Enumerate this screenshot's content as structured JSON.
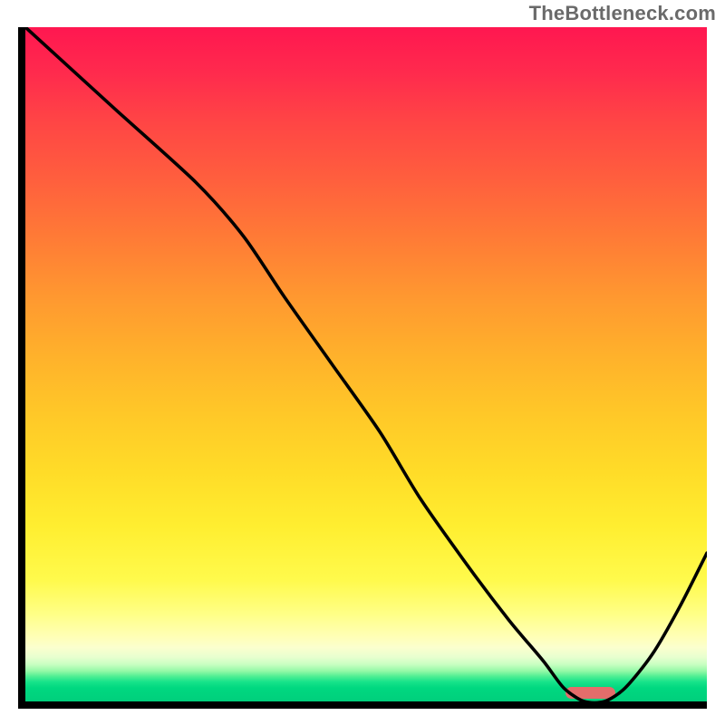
{
  "watermark": "TheBottleneck.com",
  "chart_data": {
    "type": "line",
    "title": "",
    "xlabel": "",
    "ylabel": "",
    "x": [
      0.0,
      0.13,
      0.25,
      0.32,
      0.38,
      0.45,
      0.52,
      0.58,
      0.65,
      0.71,
      0.76,
      0.79,
      0.82,
      0.85,
      0.88,
      0.92,
      0.96,
      1.0
    ],
    "y": [
      1.0,
      0.88,
      0.77,
      0.69,
      0.6,
      0.5,
      0.4,
      0.3,
      0.2,
      0.12,
      0.06,
      0.02,
      0.0,
      0.0,
      0.02,
      0.07,
      0.14,
      0.22
    ],
    "xlim": [
      0,
      1
    ],
    "ylim": [
      0,
      1
    ],
    "marker": {
      "x_start": 0.792,
      "x_end": 0.866,
      "y": 0.0
    },
    "background_gradient": {
      "top": "#ff1750",
      "mid": "#ffee30",
      "bottom": "#00cf7c"
    }
  },
  "colors": {
    "axis": "#000000",
    "curve": "#000000",
    "marker": "#e46d6b",
    "watermark": "#6a6a6a"
  }
}
